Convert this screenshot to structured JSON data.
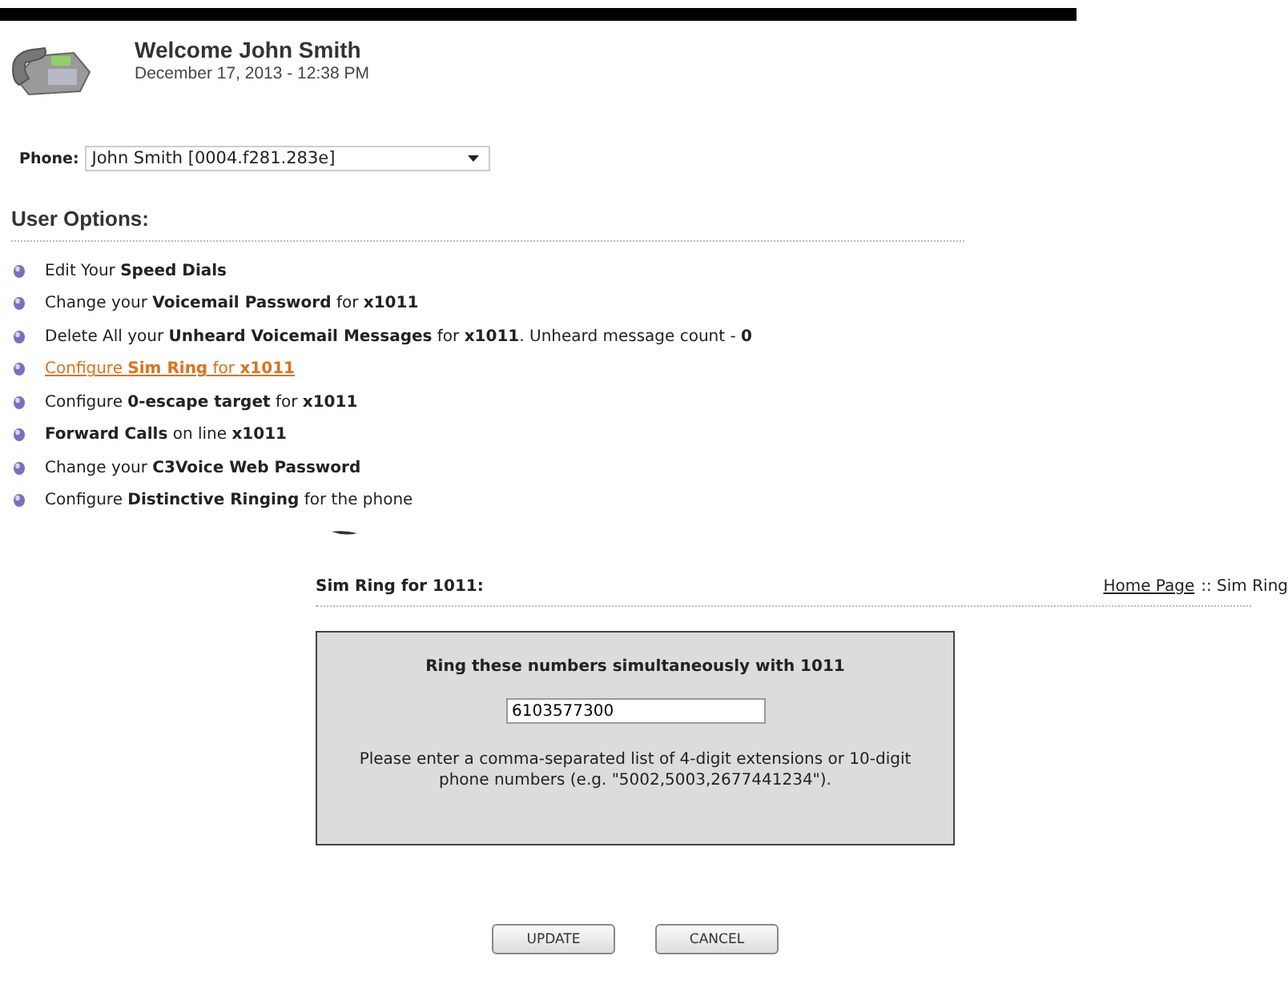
{
  "header": {
    "title": "Welcome John Smith",
    "date": "December 17, 2013 - 12:38 PM"
  },
  "phone": {
    "label": "Phone:",
    "value": "John Smith  [0004.f281.283e]"
  },
  "options_title": "User Options:",
  "options": [
    {
      "text": "Edit Your **Speed Dials**",
      "selected": false
    },
    {
      "text": "Change your **Voicemail Password** for **x1011**",
      "selected": false
    },
    {
      "text": "Delete All your **Unheard Voicemail Messages** for **x1011**. Unheard message count - **0**",
      "selected": false
    },
    {
      "text": "Configure **Sim Ring** for **x1011**",
      "selected": true
    },
    {
      "text": "Configure **0-escape target** for **x1011**",
      "selected": false
    },
    {
      "text": "**Forward Calls** on line **x1011**",
      "selected": false
    },
    {
      "text": "Change your **C3Voice Web Password**",
      "selected": false
    },
    {
      "text": "Configure **Distinctive Ringing** for the phone",
      "selected": false
    }
  ],
  "section": {
    "title": "Sim Ring for 1011:",
    "breadcrumb_link": "Home Page",
    "breadcrumb_rest": ":: Sim Ring"
  },
  "form": {
    "heading": "Ring these numbers simultaneously with 1011",
    "value": "6103577300",
    "help": "Please enter a comma-separated list of 4-digit extensions or 10-digit phone numbers (e.g. \"5002,5003,2677441234\")."
  },
  "buttons": [
    "UPDATE",
    "CANCEL"
  ]
}
